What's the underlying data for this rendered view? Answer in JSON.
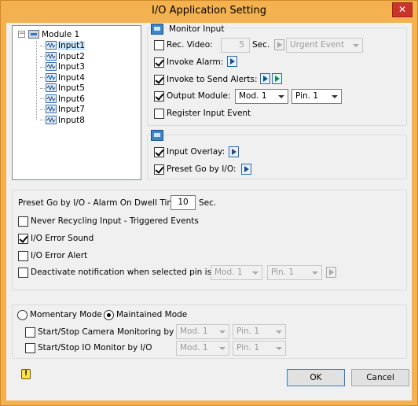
{
  "window": {
    "title": "I/O Application Setting",
    "close": "✕"
  },
  "tree": {
    "expander": "−",
    "module": "Module 1",
    "inputs": [
      "Input1",
      "Input2",
      "Input3",
      "Input4",
      "Input5",
      "Input6",
      "Input7",
      "Input8"
    ],
    "selected_index": 0
  },
  "monitor_input": {
    "title": "Monitor Input",
    "rec_video": {
      "label": "Rec. Video:",
      "checked": false,
      "value": "5",
      "unit": "Sec.",
      "event": "Urgent Event"
    },
    "invoke_alarm": {
      "label": "Invoke Alarm:",
      "checked": true
    },
    "invoke_alerts": {
      "label": "Invoke to Send Alerts:",
      "checked": true
    },
    "output_module": {
      "label": "Output Module:",
      "checked": true,
      "module": "Mod. 1",
      "pin": "Pin. 1"
    },
    "register_event": {
      "label": "Register Input Event",
      "checked": false
    }
  },
  "overlay_group": {
    "input_overlay": {
      "label": "Input Overlay:",
      "checked": true
    },
    "preset_go": {
      "label": "Preset Go by I/O:",
      "checked": true
    }
  },
  "general": {
    "dwell_label": "Preset Go by I/O - Alarm On Dwell Time:",
    "dwell_value": "10",
    "dwell_unit": "Sec.",
    "never_recycling": {
      "label": "Never Recycling Input - Triggered Events",
      "checked": false
    },
    "error_sound": {
      "label": "I/O Error Sound",
      "checked": true
    },
    "error_alert": {
      "label": "I/O Error Alert",
      "checked": false
    },
    "deactivate": {
      "label": "Deactivate notification when selected pin is ON",
      "checked": false,
      "module": "Mod. 1",
      "pin": "Pin. 1"
    }
  },
  "mode": {
    "momentary": {
      "label": "Momentary Mode",
      "checked": false
    },
    "maintained": {
      "label": "Maintained Mode",
      "checked": true
    },
    "camera_monitoring": {
      "label": "Start/Stop Camera Monitoring by I/O",
      "checked": false,
      "module": "Mod. 1",
      "pin": "Pin. 1"
    },
    "io_monitor": {
      "label": "Start/Stop IO Monitor by I/O",
      "checked": false,
      "module": "Mod. 1",
      "pin": "Pin. 1"
    }
  },
  "footer": {
    "warning": "!",
    "ok": "OK",
    "cancel": "Cancel"
  }
}
